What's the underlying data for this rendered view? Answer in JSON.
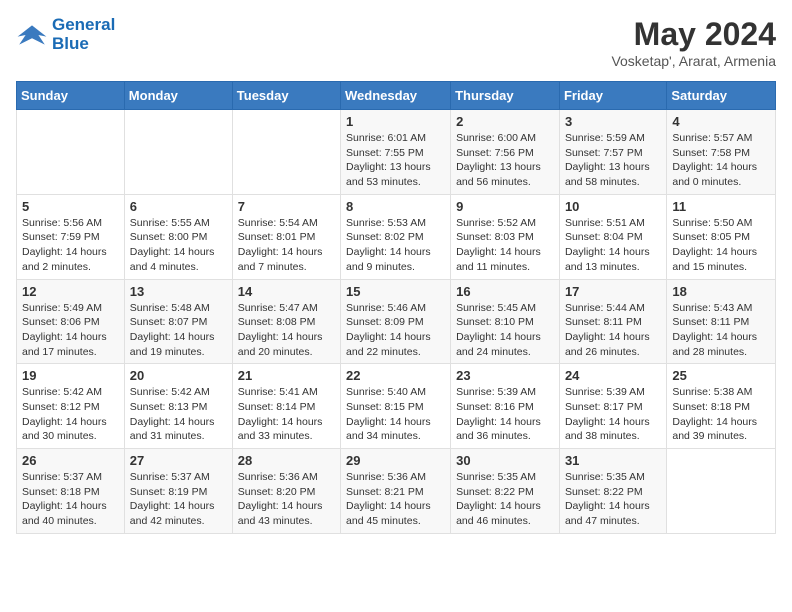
{
  "header": {
    "logo_line1": "General",
    "logo_line2": "Blue",
    "month_year": "May 2024",
    "location": "Vosketap', Ararat, Armenia"
  },
  "weekdays": [
    "Sunday",
    "Monday",
    "Tuesday",
    "Wednesday",
    "Thursday",
    "Friday",
    "Saturday"
  ],
  "weeks": [
    [
      {
        "day": "",
        "info": ""
      },
      {
        "day": "",
        "info": ""
      },
      {
        "day": "",
        "info": ""
      },
      {
        "day": "1",
        "info": "Sunrise: 6:01 AM\nSunset: 7:55 PM\nDaylight: 13 hours and 53 minutes."
      },
      {
        "day": "2",
        "info": "Sunrise: 6:00 AM\nSunset: 7:56 PM\nDaylight: 13 hours and 56 minutes."
      },
      {
        "day": "3",
        "info": "Sunrise: 5:59 AM\nSunset: 7:57 PM\nDaylight: 13 hours and 58 minutes."
      },
      {
        "day": "4",
        "info": "Sunrise: 5:57 AM\nSunset: 7:58 PM\nDaylight: 14 hours and 0 minutes."
      }
    ],
    [
      {
        "day": "5",
        "info": "Sunrise: 5:56 AM\nSunset: 7:59 PM\nDaylight: 14 hours and 2 minutes."
      },
      {
        "day": "6",
        "info": "Sunrise: 5:55 AM\nSunset: 8:00 PM\nDaylight: 14 hours and 4 minutes."
      },
      {
        "day": "7",
        "info": "Sunrise: 5:54 AM\nSunset: 8:01 PM\nDaylight: 14 hours and 7 minutes."
      },
      {
        "day": "8",
        "info": "Sunrise: 5:53 AM\nSunset: 8:02 PM\nDaylight: 14 hours and 9 minutes."
      },
      {
        "day": "9",
        "info": "Sunrise: 5:52 AM\nSunset: 8:03 PM\nDaylight: 14 hours and 11 minutes."
      },
      {
        "day": "10",
        "info": "Sunrise: 5:51 AM\nSunset: 8:04 PM\nDaylight: 14 hours and 13 minutes."
      },
      {
        "day": "11",
        "info": "Sunrise: 5:50 AM\nSunset: 8:05 PM\nDaylight: 14 hours and 15 minutes."
      }
    ],
    [
      {
        "day": "12",
        "info": "Sunrise: 5:49 AM\nSunset: 8:06 PM\nDaylight: 14 hours and 17 minutes."
      },
      {
        "day": "13",
        "info": "Sunrise: 5:48 AM\nSunset: 8:07 PM\nDaylight: 14 hours and 19 minutes."
      },
      {
        "day": "14",
        "info": "Sunrise: 5:47 AM\nSunset: 8:08 PM\nDaylight: 14 hours and 20 minutes."
      },
      {
        "day": "15",
        "info": "Sunrise: 5:46 AM\nSunset: 8:09 PM\nDaylight: 14 hours and 22 minutes."
      },
      {
        "day": "16",
        "info": "Sunrise: 5:45 AM\nSunset: 8:10 PM\nDaylight: 14 hours and 24 minutes."
      },
      {
        "day": "17",
        "info": "Sunrise: 5:44 AM\nSunset: 8:11 PM\nDaylight: 14 hours and 26 minutes."
      },
      {
        "day": "18",
        "info": "Sunrise: 5:43 AM\nSunset: 8:11 PM\nDaylight: 14 hours and 28 minutes."
      }
    ],
    [
      {
        "day": "19",
        "info": "Sunrise: 5:42 AM\nSunset: 8:12 PM\nDaylight: 14 hours and 30 minutes."
      },
      {
        "day": "20",
        "info": "Sunrise: 5:42 AM\nSunset: 8:13 PM\nDaylight: 14 hours and 31 minutes."
      },
      {
        "day": "21",
        "info": "Sunrise: 5:41 AM\nSunset: 8:14 PM\nDaylight: 14 hours and 33 minutes."
      },
      {
        "day": "22",
        "info": "Sunrise: 5:40 AM\nSunset: 8:15 PM\nDaylight: 14 hours and 34 minutes."
      },
      {
        "day": "23",
        "info": "Sunrise: 5:39 AM\nSunset: 8:16 PM\nDaylight: 14 hours and 36 minutes."
      },
      {
        "day": "24",
        "info": "Sunrise: 5:39 AM\nSunset: 8:17 PM\nDaylight: 14 hours and 38 minutes."
      },
      {
        "day": "25",
        "info": "Sunrise: 5:38 AM\nSunset: 8:18 PM\nDaylight: 14 hours and 39 minutes."
      }
    ],
    [
      {
        "day": "26",
        "info": "Sunrise: 5:37 AM\nSunset: 8:18 PM\nDaylight: 14 hours and 40 minutes."
      },
      {
        "day": "27",
        "info": "Sunrise: 5:37 AM\nSunset: 8:19 PM\nDaylight: 14 hours and 42 minutes."
      },
      {
        "day": "28",
        "info": "Sunrise: 5:36 AM\nSunset: 8:20 PM\nDaylight: 14 hours and 43 minutes."
      },
      {
        "day": "29",
        "info": "Sunrise: 5:36 AM\nSunset: 8:21 PM\nDaylight: 14 hours and 45 minutes."
      },
      {
        "day": "30",
        "info": "Sunrise: 5:35 AM\nSunset: 8:22 PM\nDaylight: 14 hours and 46 minutes."
      },
      {
        "day": "31",
        "info": "Sunrise: 5:35 AM\nSunset: 8:22 PM\nDaylight: 14 hours and 47 minutes."
      },
      {
        "day": "",
        "info": ""
      }
    ]
  ]
}
